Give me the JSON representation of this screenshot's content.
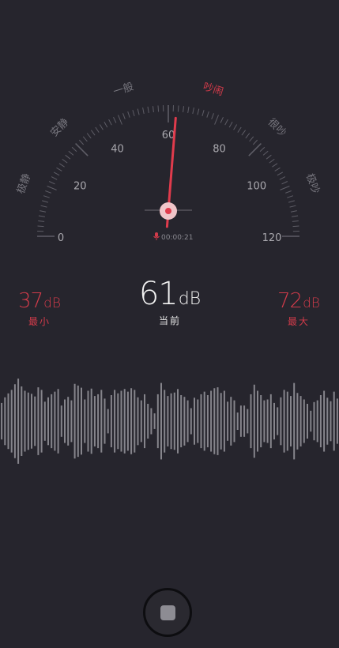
{
  "gauge": {
    "zones": [
      {
        "label": "极静",
        "angle": -70,
        "color": "#77767e"
      },
      {
        "label": "安静",
        "angle": -45,
        "color": "#77767e"
      },
      {
        "label": "一般",
        "angle": -17,
        "color": "#77767e"
      },
      {
        "label": "吵闹",
        "angle": 17,
        "color": "#d23b4a"
      },
      {
        "label": "很吵",
        "angle": 45,
        "color": "#77767e"
      },
      {
        "label": "极吵",
        "angle": 70,
        "color": "#77767e"
      }
    ],
    "ticks": [
      "0",
      "20",
      "40",
      "60",
      "80",
      "100",
      "120"
    ],
    "min_value": 0,
    "max_value": 120,
    "needle_value": 63,
    "timer": "00:00:21"
  },
  "stats": {
    "min": {
      "value": "37",
      "unit": "dB",
      "label": "最小"
    },
    "current": {
      "value": "61",
      "unit": "dB",
      "label": "当前"
    },
    "max": {
      "value": "72",
      "unit": "dB",
      "label": "最大"
    }
  },
  "waveform": [
    0.42,
    0.55,
    0.64,
    0.72,
    0.85,
    0.98,
    0.8,
    0.7,
    0.66,
    0.63,
    0.57,
    0.78,
    0.72,
    0.45,
    0.55,
    0.62,
    0.68,
    0.74,
    0.36,
    0.5,
    0.56,
    0.48,
    0.86,
    0.82,
    0.77,
    0.5,
    0.7,
    0.75,
    0.58,
    0.62,
    0.72,
    0.52,
    0.28,
    0.6,
    0.72,
    0.64,
    0.7,
    0.74,
    0.68,
    0.76,
    0.72,
    0.55,
    0.48,
    0.62,
    0.4,
    0.3,
    0.18,
    0.62,
    0.88,
    0.72,
    0.58,
    0.64,
    0.66,
    0.74,
    0.6,
    0.56,
    0.48,
    0.3,
    0.54,
    0.5,
    0.62,
    0.68,
    0.6,
    0.7,
    0.76,
    0.78,
    0.65,
    0.7,
    0.45,
    0.56,
    0.48,
    0.2,
    0.36,
    0.36,
    0.28,
    0.62,
    0.84,
    0.7,
    0.6,
    0.48,
    0.5,
    0.62,
    0.42,
    0.32,
    0.55,
    0.72,
    0.68,
    0.58,
    0.88,
    0.65,
    0.58,
    0.5,
    0.4,
    0.24,
    0.44,
    0.48,
    0.6,
    0.7,
    0.54,
    0.46,
    0.68,
    0.52
  ],
  "colors": {
    "background": "#26252d",
    "accent": "#d23b4a",
    "dial": "#5e5d66",
    "text_muted": "#8a8990"
  },
  "controls": {
    "stop_icon": "stop-square-icon"
  }
}
